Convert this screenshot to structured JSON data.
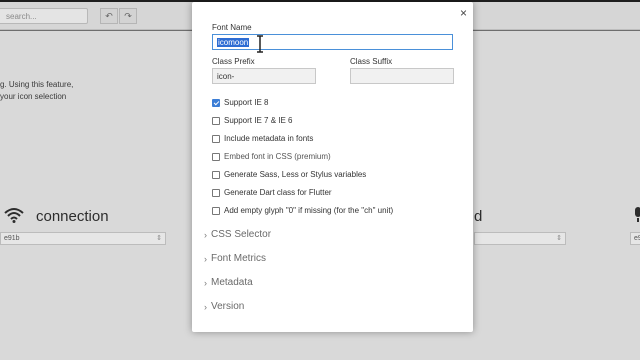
{
  "background": {
    "search_placeholder": "search...",
    "undo_icon": "↶",
    "redo_icon": "↷",
    "text_line1": "g. Using this feature,",
    "text_line2": "your icon selection",
    "glyph_left_name": "connection",
    "glyph_left_code": "e91b",
    "glyph_right_name": "d",
    "glyph_right_code": "e9"
  },
  "modal": {
    "close_label": "×",
    "font_name_label": "Font Name",
    "font_name_value": "icomoon",
    "class_prefix_label": "Class Prefix",
    "class_prefix_value": "icon-",
    "class_suffix_label": "Class Suffix",
    "class_suffix_value": "",
    "options": [
      {
        "label": "Support IE 8",
        "checked": true
      },
      {
        "label": "Support IE 7 & IE 6",
        "checked": false
      },
      {
        "label": "Include metadata in fonts",
        "checked": false
      },
      {
        "label": "Embed font in CSS  (premium)",
        "checked": false
      },
      {
        "label": "Generate Sass, Less or Stylus variables",
        "checked": false
      },
      {
        "label": "Generate Dart class for Flutter",
        "checked": false
      },
      {
        "label": "Add empty glyph \"0\" if missing (for the \"ch\" unit)",
        "checked": false
      }
    ],
    "sections": [
      "CSS Selector",
      "Font Metrics",
      "Metadata",
      "Version"
    ]
  }
}
